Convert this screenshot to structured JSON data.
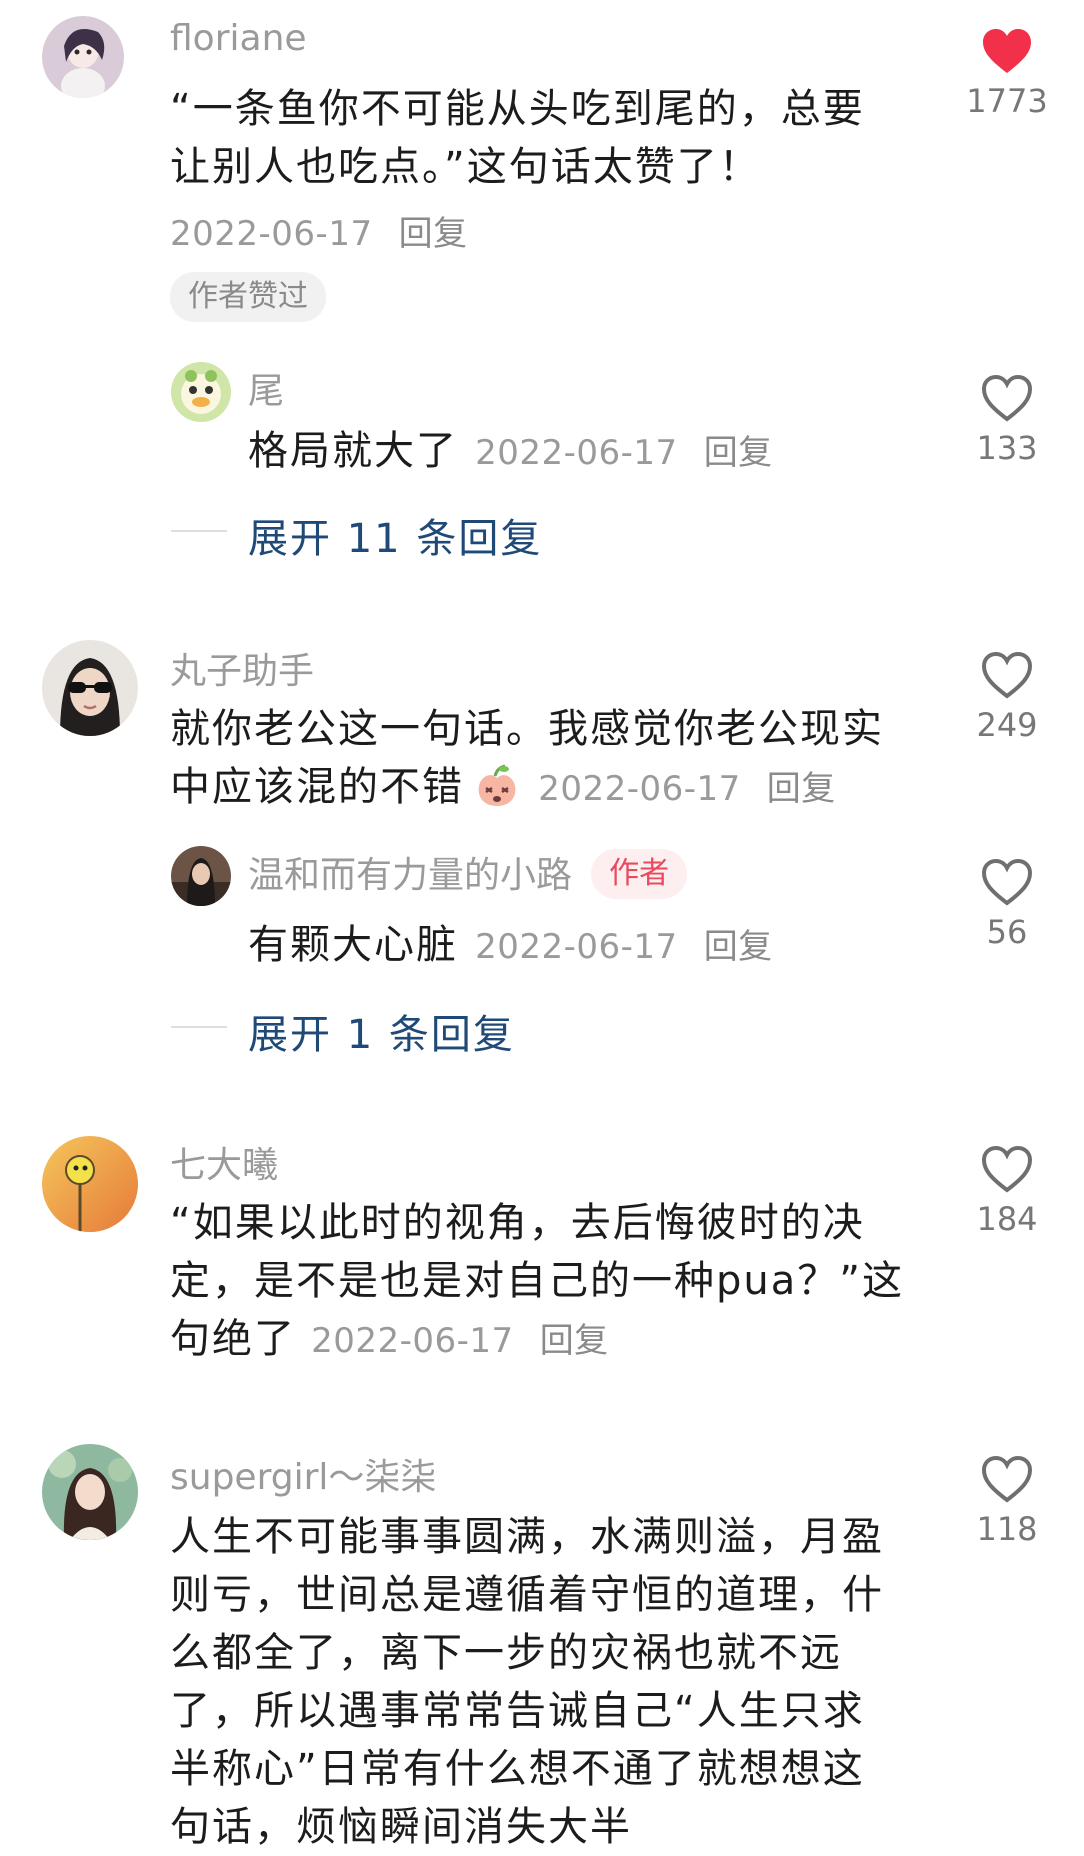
{
  "comments": [
    {
      "username": "floriane",
      "text": [
        "“一条鱼你不可能从头吃到尾的，总要",
        "让别人也吃点。”这句话太赞了！"
      ],
      "date": "2022-06-17",
      "reply_label": "回复",
      "badge": "作者赞过",
      "likes": "1773",
      "liked": true,
      "sub_reply": {
        "username": "尾",
        "text": "格局就大了",
        "date": "2022-06-17",
        "reply_label": "回复",
        "likes": "133"
      },
      "expand_label": "展开 11 条回复"
    },
    {
      "username": "丸子助手",
      "text": [
        "就你老公这一句话。我感觉你老公现实"
      ],
      "text_last": "中应该混的不错",
      "date": "2022-06-17",
      "reply_label": "回复",
      "likes": "249",
      "sub_reply": {
        "username": "温和而有力量的小路",
        "tag": "作者",
        "text": "有颗大心脏",
        "date": "2022-06-17",
        "reply_label": "回复",
        "likes": "56"
      },
      "expand_label": "展开 1 条回复"
    },
    {
      "username": "七大曦",
      "text": [
        "“如果以此时的视角，去后悔彼时的决",
        "定，是不是也是对自己的一种pua？”这"
      ],
      "text_last": "句绝了",
      "date": "2022-06-17",
      "reply_label": "回复",
      "likes": "184"
    },
    {
      "username": "supergirl～柒柒",
      "text": [
        "人生不可能事事圆满，水满则溢，月盈",
        "则亏，世间总是遵循着守恒的道理，什",
        "么都全了，离下一步的灾祸也就不远",
        "了，所以遇事常常告诫自己“人生只求",
        "半称心”日常有什么想不通了就想想这",
        "句话，烦恼瞬间消失大半"
      ],
      "likes": "118"
    }
  ],
  "icons": {
    "like": "heart-icon",
    "liked_color": "#f2304a",
    "outline_color": "#6f6f6f",
    "emoji": "peach-emoji-icon"
  }
}
